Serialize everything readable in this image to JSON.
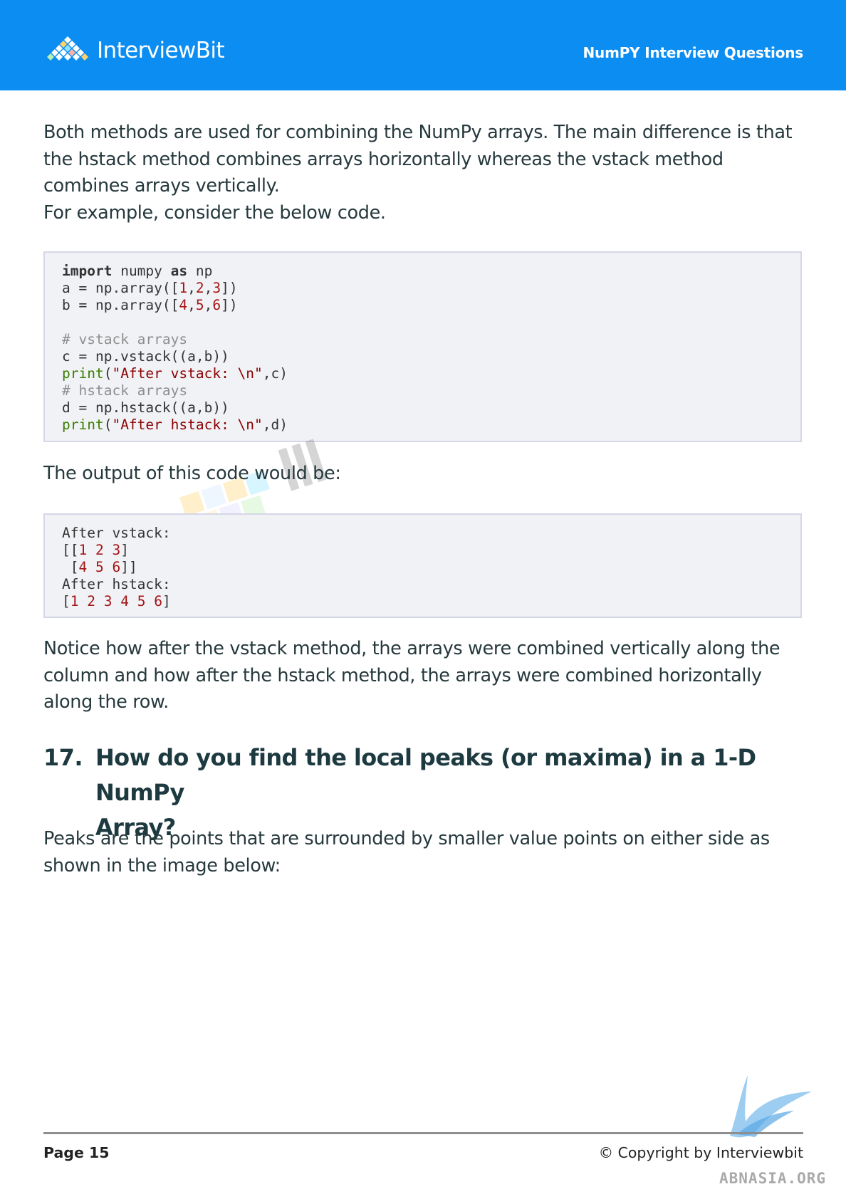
{
  "header": {
    "brand": "InterviewBit",
    "doc_title": "NumPY Interview Questions"
  },
  "intro": {
    "line1": "Both methods are used for combining the NumPy arrays. The main difference is that",
    "line2": "the hstack method combines arrays horizontally whereas the vstack method",
    "line3": "combines arrays vertically.",
    "line4": "For example, consider the below code."
  },
  "code_block": {
    "import_kw": "import",
    "module": "numpy",
    "as_kw": "as",
    "alias": "np",
    "line_a": "a = np.array([",
    "a_vals": [
      "1",
      "2",
      "3"
    ],
    "line_b": "b = np.array([",
    "b_vals": [
      "4",
      "5",
      "6"
    ],
    "comment_vstack": "# vstack arrays",
    "line_c": "c = np.vstack((a,b))",
    "print_kw": "print",
    "print1_str": "\"After vstack: \\n\"",
    "print1_arg": ",c)",
    "comment_hstack": "# hstack arrays",
    "line_d": "d = np.hstack((a,b))",
    "print2_str": "\"After hstack: \\n\"",
    "print2_arg": ",d)"
  },
  "output_intro": "The output of this code would be:",
  "output_block": {
    "label_vstack": "After vstack:",
    "row1": [
      "1",
      "2",
      "3"
    ],
    "row2": [
      "4",
      "5",
      "6"
    ],
    "label_hstack": "After hstack:",
    "row3": [
      "1",
      "2",
      "3",
      "4",
      "5",
      "6"
    ]
  },
  "notice": {
    "line1": "Notice how after the vstack method, the arrays were combined vertically along the",
    "line2": "column and how after the hstack method, the arrays were combined horizontally",
    "line3": "along the row."
  },
  "question": {
    "number": "17.",
    "line1": "How do you find the local peaks (or maxima) in a 1-D NumPy",
    "line2": "Array?"
  },
  "peaks_text": {
    "line1": "Peaks are the points that are surrounded by smaller value points on either side as",
    "line2": "shown in the image below:"
  },
  "footer": {
    "page": "Page 15",
    "copyright": "© Copyright by Interviewbit",
    "stamp": "ABNASIA.ORG"
  },
  "colors": {
    "header_bg": "#0b8df2",
    "code_bg": "#f1f2f6",
    "text": "#26393d"
  }
}
